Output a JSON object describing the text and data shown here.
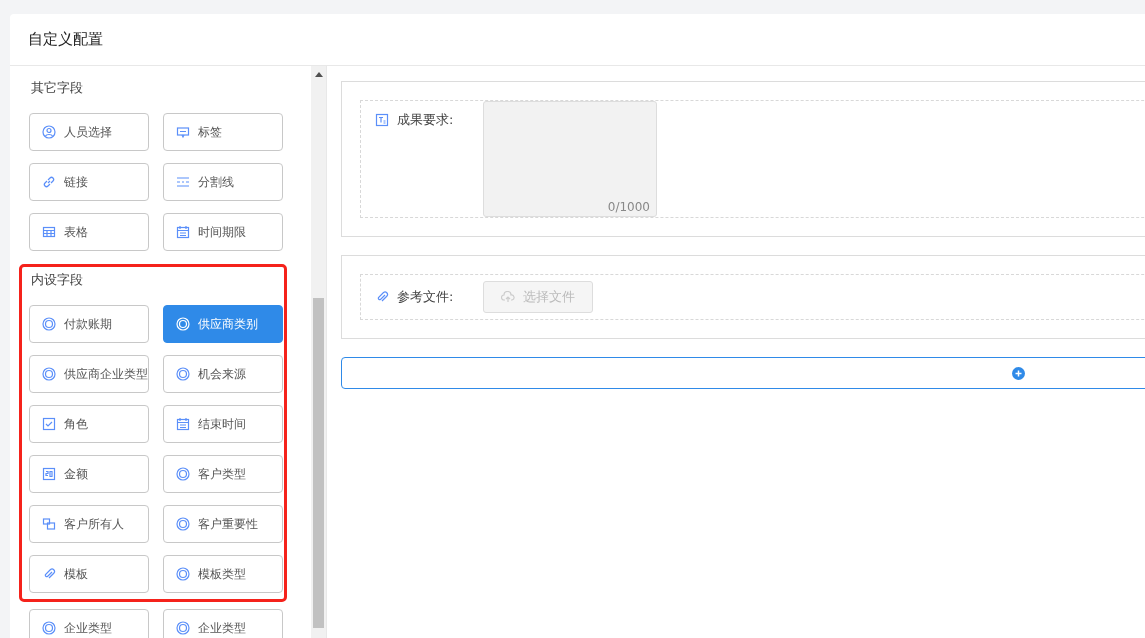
{
  "window": {
    "title": "自定义配置"
  },
  "sections": [
    {
      "title": "其它字段",
      "highlighted": false,
      "items": [
        {
          "label": "人员选择",
          "kind": "user",
          "selected": false
        },
        {
          "label": "标签",
          "kind": "tag",
          "selected": false
        },
        {
          "label": "链接",
          "kind": "link",
          "selected": false
        },
        {
          "label": "分割线",
          "kind": "divider",
          "selected": false
        },
        {
          "label": "表格",
          "kind": "table",
          "selected": false
        },
        {
          "label": "时间期限",
          "kind": "calendar",
          "selected": false
        }
      ]
    },
    {
      "title": "内设字段",
      "highlighted": true,
      "items": [
        {
          "label": "付款账期",
          "kind": "radio",
          "selected": false
        },
        {
          "label": "供应商类别",
          "kind": "radio",
          "selected": true
        },
        {
          "label": "供应商企业类型",
          "kind": "radio",
          "selected": false
        },
        {
          "label": "机会来源",
          "kind": "radio",
          "selected": false
        },
        {
          "label": "角色",
          "kind": "checkbox",
          "selected": false
        },
        {
          "label": "结束时间",
          "kind": "calendar",
          "selected": false
        },
        {
          "label": "金额",
          "kind": "money",
          "selected": false
        },
        {
          "label": "客户类型",
          "kind": "radio",
          "selected": false
        },
        {
          "label": "客户所有人",
          "kind": "owner",
          "selected": false
        },
        {
          "label": "客户重要性",
          "kind": "radio",
          "selected": false
        },
        {
          "label": "模板",
          "kind": "clip",
          "selected": false
        },
        {
          "label": "模板类型",
          "kind": "radio",
          "selected": false
        }
      ]
    },
    {
      "highlighted": false,
      "items": [
        {
          "label": "企业类型",
          "kind": "radio",
          "selected": false
        },
        {
          "label": "企业类型",
          "kind": "radio",
          "selected": false
        }
      ]
    }
  ],
  "form": [
    {
      "kind": "textarea",
      "label": "成果要求:",
      "count": "0/1000"
    },
    {
      "kind": "upload",
      "label": "参考文件:",
      "button": "选择文件",
      "disabled": true
    }
  ]
}
